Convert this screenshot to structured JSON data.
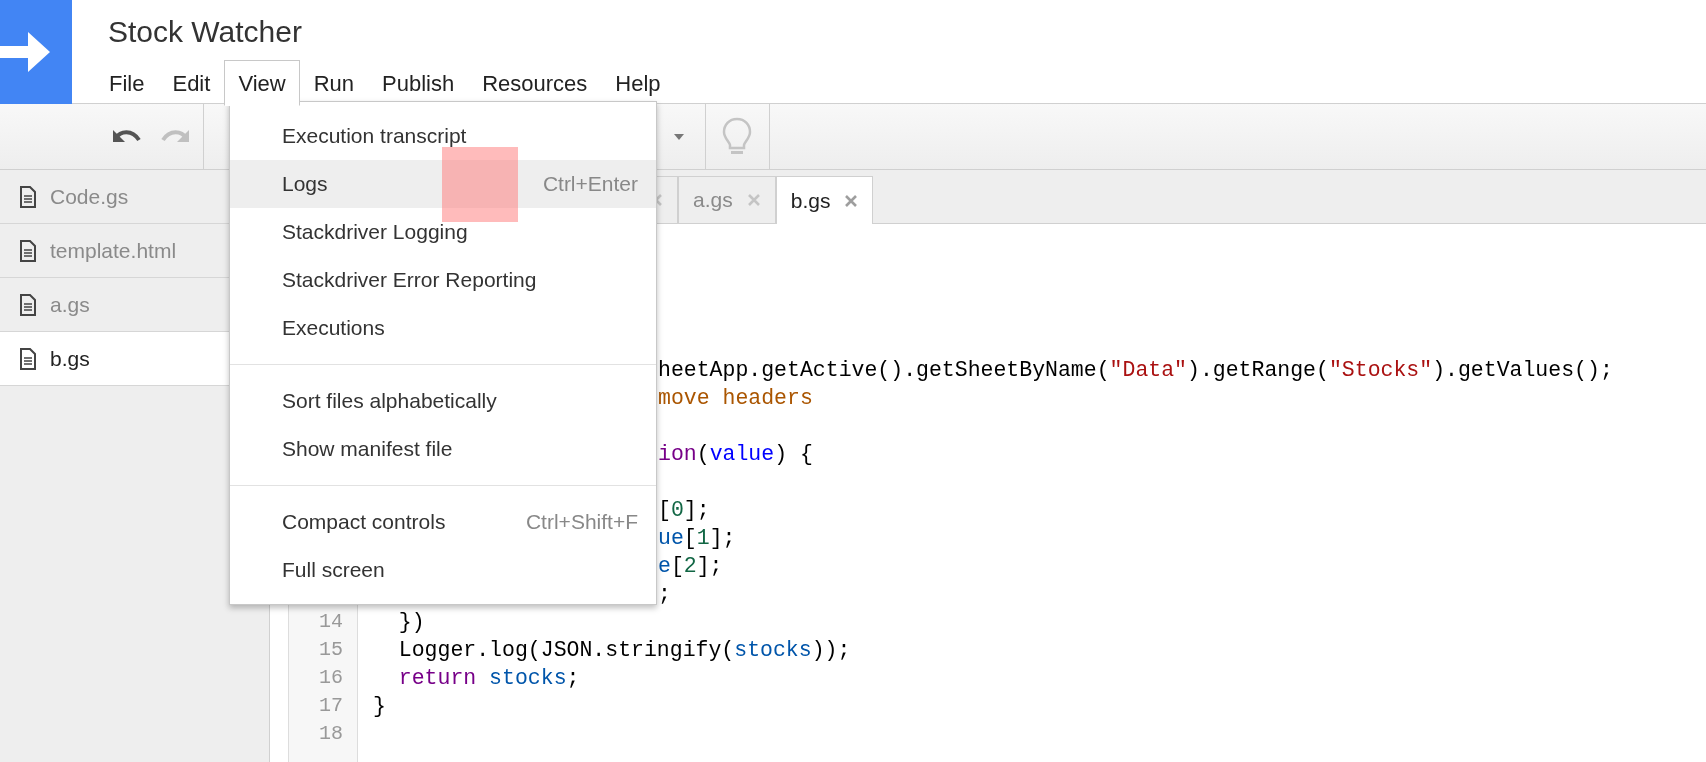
{
  "app": {
    "title": "Stock Watcher"
  },
  "menubar": [
    {
      "label": "File",
      "selected": false
    },
    {
      "label": "Edit",
      "selected": false
    },
    {
      "label": "View",
      "selected": true
    },
    {
      "label": "Run",
      "selected": false
    },
    {
      "label": "Publish",
      "selected": false
    },
    {
      "label": "Resources",
      "selected": false
    },
    {
      "label": "Help",
      "selected": false
    }
  ],
  "toolbar": {
    "undo": {
      "disabled": false
    },
    "redo": {
      "disabled": true
    }
  },
  "sidebar": {
    "items": [
      {
        "label": "Code.gs",
        "selected": false
      },
      {
        "label": "template.html",
        "selected": false
      },
      {
        "label": "a.gs",
        "selected": false
      },
      {
        "label": "b.gs",
        "selected": true
      }
    ]
  },
  "tabs": [
    {
      "selected": false
    },
    {
      "label": "a.gs",
      "selected": false
    },
    {
      "label": "b.gs",
      "selected": true
    }
  ],
  "editor": {
    "lines": [
      {
        "clipped": true,
        "segments": [
          {
            "kind": "plain",
            "text": "heetApp.getActive().getSheetByName("
          },
          {
            "kind": "string",
            "text": "\"Data\""
          },
          {
            "kind": "plain",
            "text": ").getRange("
          },
          {
            "kind": "string",
            "text": "\"Stocks\""
          },
          {
            "kind": "plain",
            "text": ").getValues();"
          }
        ]
      },
      {
        "clipped": true,
        "segments": [
          {
            "kind": "comment",
            "text": "move headers"
          }
        ]
      },
      {
        "clipped": true,
        "after_blank": true,
        "segments": [
          {
            "kind": "keyword",
            "text": "ion"
          },
          {
            "kind": "plain",
            "text": "("
          },
          {
            "kind": "def",
            "text": "value"
          },
          {
            "kind": "plain",
            "text": ") {"
          }
        ]
      },
      {
        "clipped": true,
        "after_blank": true,
        "segments": [
          {
            "kind": "plain",
            "text": "["
          },
          {
            "kind": "number",
            "text": "0"
          },
          {
            "kind": "plain",
            "text": "];"
          }
        ]
      },
      {
        "clipped": true,
        "segments": [
          {
            "kind": "variable",
            "text": "ue"
          },
          {
            "kind": "plain",
            "text": "["
          },
          {
            "kind": "number",
            "text": "1"
          },
          {
            "kind": "plain",
            "text": "];"
          }
        ]
      },
      {
        "clipped": true,
        "segments": [
          {
            "kind": "variable",
            "text": "e"
          },
          {
            "kind": "plain",
            "text": "["
          },
          {
            "kind": "number",
            "text": "2"
          },
          {
            "kind": "plain",
            "text": "];"
          }
        ]
      },
      {
        "clipped": true,
        "segments": [
          {
            "kind": "plain",
            "text": ";"
          }
        ]
      },
      {
        "number": "14",
        "segments": [
          {
            "kind": "plain",
            "text": "  })"
          }
        ]
      },
      {
        "number": "15",
        "segments": [
          {
            "kind": "plain",
            "text": "  Logger.log(JSON.stringify("
          },
          {
            "kind": "variable",
            "text": "stocks"
          },
          {
            "kind": "plain",
            "text": "));"
          }
        ]
      },
      {
        "number": "16",
        "segments": [
          {
            "kind": "keyword",
            "text": "  return"
          },
          {
            "kind": "variable",
            "text": " stocks"
          },
          {
            "kind": "plain",
            "text": ";"
          }
        ]
      },
      {
        "number": "17",
        "segments": [
          {
            "kind": "plain",
            "text": "}"
          }
        ]
      },
      {
        "number": "18"
      }
    ]
  },
  "view_menu": {
    "groups": [
      [
        {
          "label": "Execution transcript",
          "selected": false
        },
        {
          "label": "Logs",
          "shortcut": "Ctrl+Enter",
          "selected": true
        },
        {
          "label": "Stackdriver Logging",
          "selected": false
        },
        {
          "label": "Stackdriver Error Reporting",
          "selected": false
        },
        {
          "label": "Executions",
          "selected": false
        }
      ],
      [
        {
          "label": "Sort files alphabetically",
          "selected": false
        },
        {
          "label": "Show manifest file",
          "selected": false
        }
      ],
      [
        {
          "label": "Compact controls",
          "shortcut": "Ctrl+Shift+F",
          "selected": false
        },
        {
          "label": "Full screen",
          "selected": false
        }
      ]
    ]
  }
}
